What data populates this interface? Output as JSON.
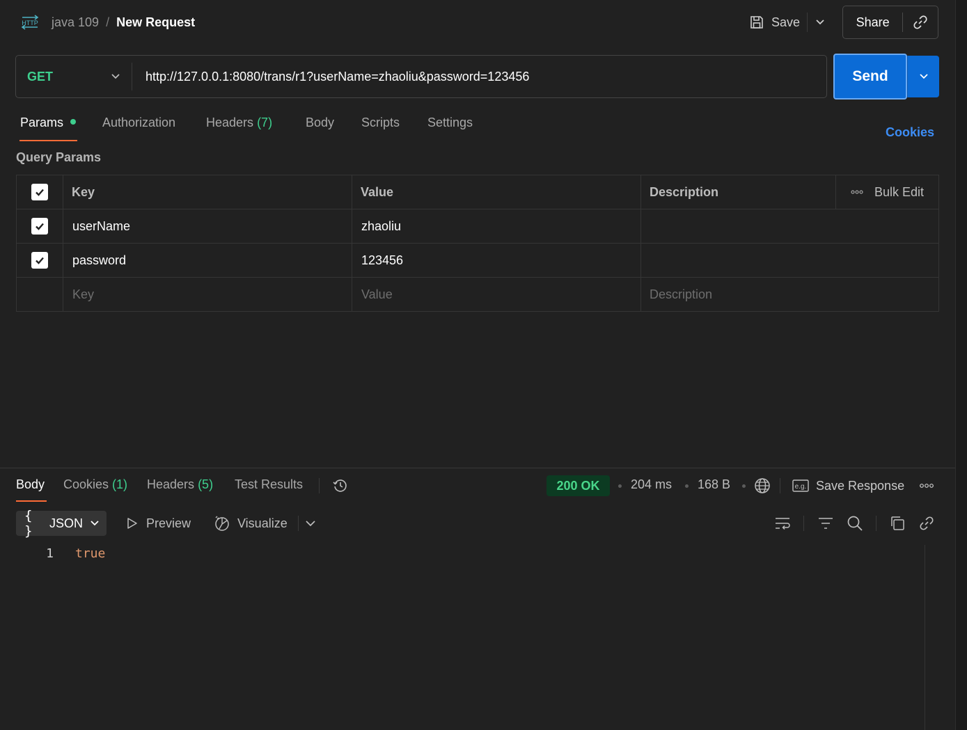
{
  "header": {
    "http_icon_label": "HTTP",
    "breadcrumb_parent": "java 109",
    "breadcrumb_separator": "/",
    "title": "New Request",
    "save_label": "Save",
    "share_label": "Share",
    "icons": [
      "http-icon",
      "save-icon",
      "chevron-down-icon",
      "link-icon"
    ]
  },
  "request": {
    "method": "GET",
    "url": "http://127.0.0.1:8080/trans/r1?userName=zhaoliu&password=123456",
    "send_label": "Send"
  },
  "request_tabs": {
    "params": "Params",
    "authorization": "Authorization",
    "headers": "Headers",
    "headers_count": "(7)",
    "body": "Body",
    "scripts": "Scripts",
    "settings": "Settings",
    "active": "Params"
  },
  "cookies_link": "Cookies",
  "query_params": {
    "title": "Query Params",
    "columns": {
      "key": "Key",
      "value": "Value",
      "description": "Description"
    },
    "bulk_edit_label": "Bulk Edit",
    "rows": [
      {
        "checked": true,
        "key": "userName",
        "value": "zhaoliu",
        "description": ""
      },
      {
        "checked": true,
        "key": "password",
        "value": "123456",
        "description": ""
      }
    ],
    "placeholders": {
      "key": "Key",
      "value": "Value",
      "description": "Description"
    }
  },
  "response_tabs": {
    "body": "Body",
    "cookies": "Cookies",
    "cookies_count": "(1)",
    "headers": "Headers",
    "headers_count": "(5)",
    "test_results": "Test Results",
    "active": "Body"
  },
  "response_meta": {
    "status": "200 OK",
    "time": "204 ms",
    "size": "168 B",
    "save_response_label": "Save Response",
    "status_color": "#49d68a"
  },
  "body_toolbar": {
    "format_label": "JSON",
    "preview_label": "Preview",
    "visualize_label": "Visualize",
    "icons": [
      "wrap-lines-icon",
      "filter-icon",
      "search-icon",
      "copy-icon",
      "link-icon"
    ]
  },
  "code": {
    "lines": [
      {
        "number": "1",
        "text": "true"
      }
    ]
  },
  "colors": {
    "accent": "#ff6c37",
    "send_blue": "#0b6bd6",
    "method_green": "#3ecf8e",
    "link_blue": "#3d8df5"
  }
}
